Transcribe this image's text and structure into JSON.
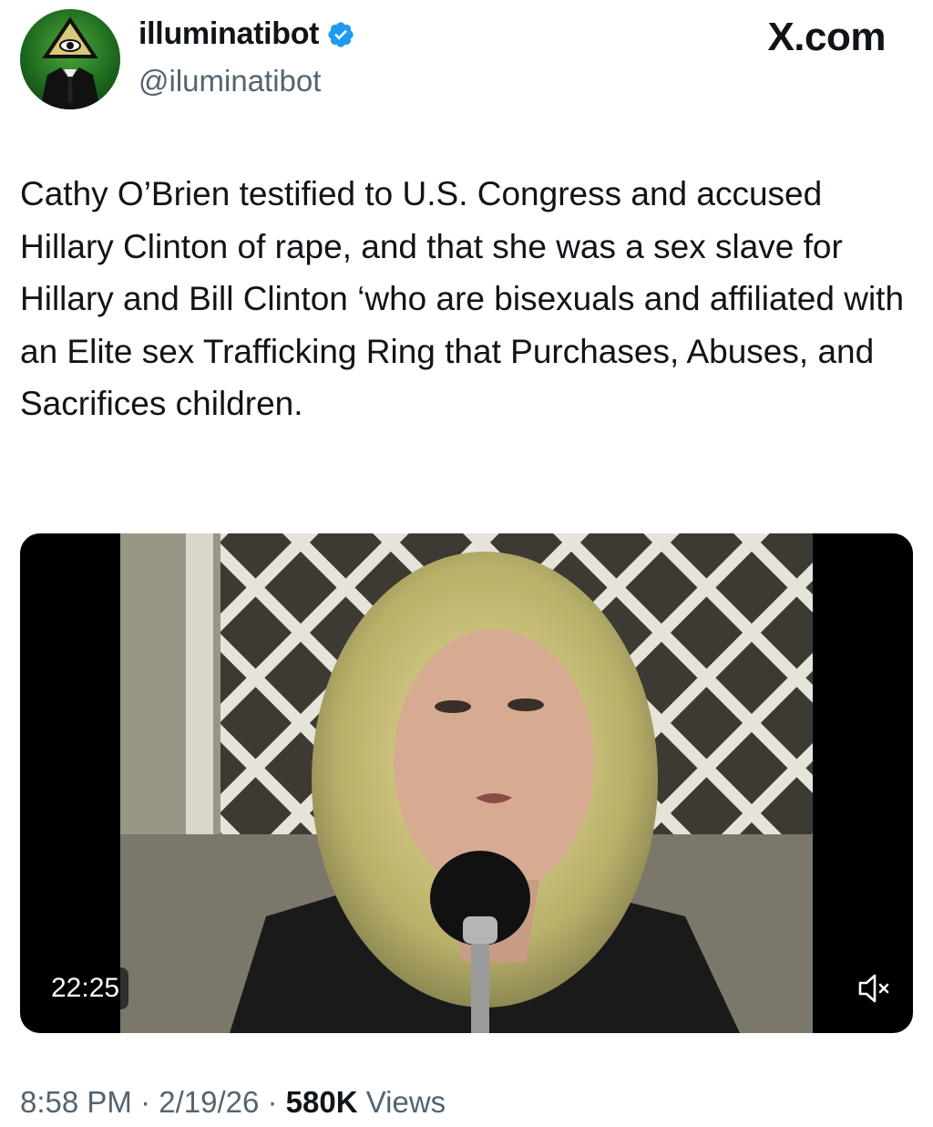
{
  "author": {
    "display_name": "illuminatibot",
    "handle": "@iluminatibot",
    "verified": true,
    "avatar_icon": "eye-pyramid-suit-avatar"
  },
  "brand": {
    "label": "X.com"
  },
  "tweet": {
    "text": "Cathy O’Brien testified to U.S. Congress and accused Hillary Clinton of rape, and that she was a sex slave for Hillary and Bill Clinton ‘who are bisexuals and affiliated with an Elite sex Trafficking Ring that Purchases, Abuses, and Sacrifices children."
  },
  "media": {
    "duration": "22:25",
    "mute_icon": "speaker-muted-icon"
  },
  "meta": {
    "time": "8:58 PM",
    "sep1": " · ",
    "date": "2/19/26",
    "sep2": " · ",
    "views_count": "580K",
    "views_label": " Views"
  },
  "colors": {
    "verified": "#1d9bf0",
    "secondary_text": "#536471",
    "primary_text": "#0f1419"
  }
}
